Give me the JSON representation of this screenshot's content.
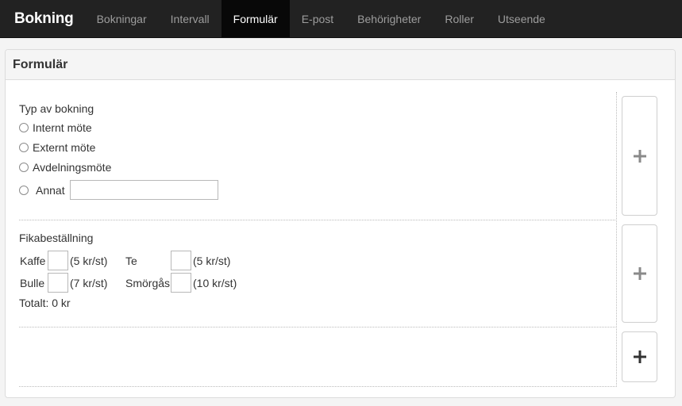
{
  "navbar": {
    "brand": "Bokning",
    "items": [
      {
        "label": "Bokningar",
        "active": false
      },
      {
        "label": "Intervall",
        "active": false
      },
      {
        "label": "Formulär",
        "active": true
      },
      {
        "label": "E-post",
        "active": false
      },
      {
        "label": "Behörigheter",
        "active": false
      },
      {
        "label": "Roller",
        "active": false
      },
      {
        "label": "Utseende",
        "active": false
      }
    ]
  },
  "panel": {
    "title": "Formulär"
  },
  "booking_type": {
    "title": "Typ av bokning",
    "options": [
      "Internt möte",
      "Externt möte",
      "Avdelningsmöte",
      "Annat"
    ],
    "other_value": ""
  },
  "fika": {
    "title": "Fikabeställning",
    "items": [
      {
        "name": "Kaffe",
        "price": "(5 kr/st)",
        "quantity": ""
      },
      {
        "name": "Te",
        "price": "(5 kr/st)",
        "quantity": ""
      },
      {
        "name": "Bulle",
        "price": "(7 kr/st)",
        "quantity": ""
      },
      {
        "name": "Smörgås",
        "price": "(10 kr/st)",
        "quantity": ""
      }
    ],
    "total": "Totalt: 0 kr"
  },
  "colors": {
    "navbar_bg": "#222222",
    "nav_active_bg": "#080808",
    "plus_active": "#333333",
    "plus_muted": "#8a8a8a"
  },
  "icons": {
    "add_section": "plus-icon"
  }
}
